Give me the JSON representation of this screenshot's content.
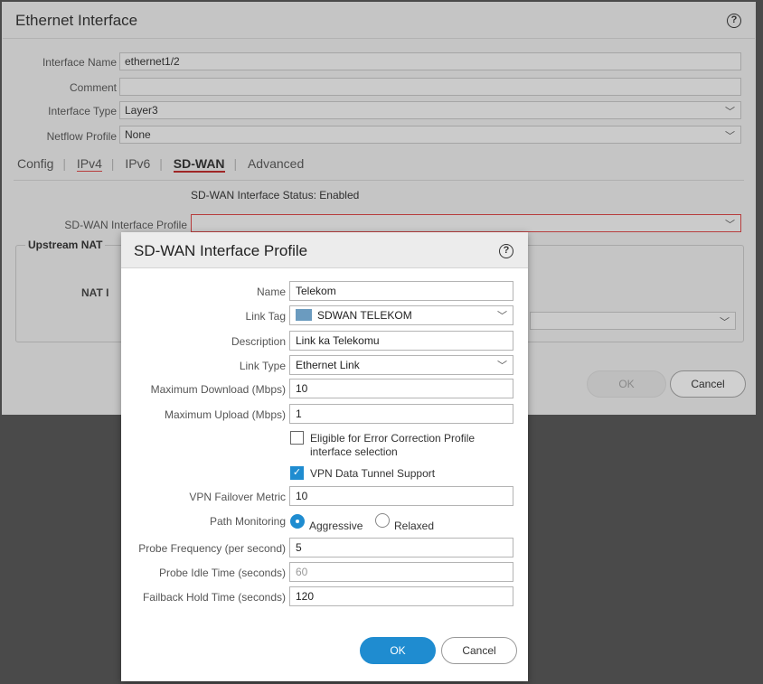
{
  "outer": {
    "title": "Ethernet Interface",
    "fields": [
      {
        "label": "Interface Name",
        "value": "ethernet1/2"
      },
      {
        "label": "Comment",
        "value": ""
      },
      {
        "label": "Interface Type",
        "value": "Layer3"
      },
      {
        "label": "Netflow Profile",
        "value": "None"
      }
    ],
    "tabs": [
      "Config",
      "IPv4",
      "IPv6",
      "SD-WAN",
      "Advanced"
    ],
    "active_tab": "SD-WAN",
    "sdwan_status": "SD-WAN Interface Status: Enabled",
    "sdwan_profile_label": "SD-WAN Interface Profile",
    "sdwan_profile_value": "",
    "upstream_nat_legend": "Upstream NAT",
    "nat_partial_label": "NAT I",
    "ok_label": "OK",
    "cancel_label": "Cancel"
  },
  "modal": {
    "title": "SD-WAN Interface Profile",
    "name_label": "Name",
    "name_value": "Telekom",
    "link_tag_label": "Link Tag",
    "link_tag_value": "SDWAN TELEKOM",
    "description_label": "Description",
    "description_value": "Link ka Telekomu",
    "link_type_label": "Link Type",
    "link_type_value": "Ethernet Link",
    "max_download_label": "Maximum Download (Mbps)",
    "max_download_value": "10",
    "max_upload_label": "Maximum Upload (Mbps)",
    "max_upload_value": "1",
    "eligible_label_line1": "Eligible for Error Correction Profile",
    "eligible_label_line2": "interface selection",
    "eligible_checked": false,
    "vpn_tunnel_label": "VPN Data Tunnel Support",
    "vpn_tunnel_checked": true,
    "vpn_failover_label": "VPN Failover Metric",
    "vpn_failover_value": "10",
    "path_monitoring_label": "Path Monitoring",
    "path_monitoring_options": [
      "Aggressive",
      "Relaxed"
    ],
    "path_monitoring_selected": "Aggressive",
    "probe_frequency_label": "Probe Frequency (per second)",
    "probe_frequency_value": "5",
    "probe_idle_label": "Probe Idle Time (seconds)",
    "probe_idle_value": "60",
    "failback_label": "Failback Hold Time (seconds)",
    "failback_value": "120",
    "ok_label": "OK",
    "cancel_label": "Cancel"
  },
  "colors": {
    "accent": "#1f8cd0",
    "error": "#b32c2c",
    "link_tag_swatch": "#6b9bbf"
  }
}
